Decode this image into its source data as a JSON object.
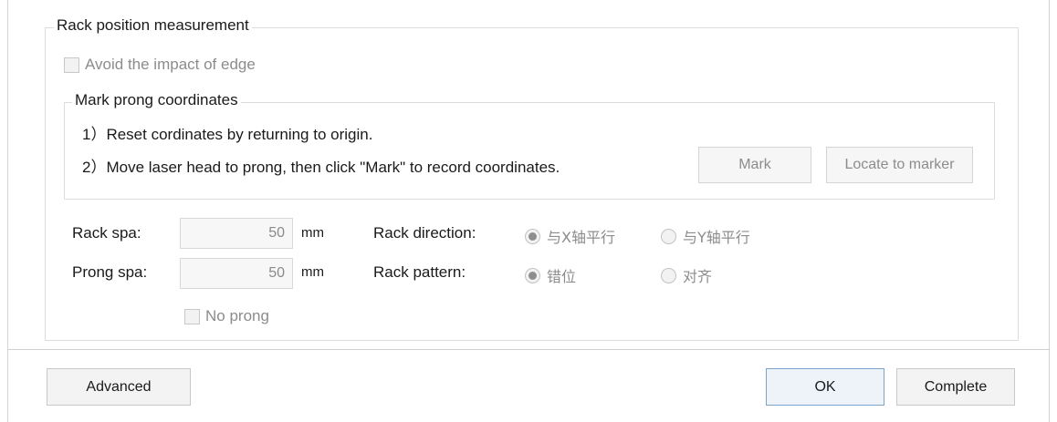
{
  "rack_group": {
    "title": "Rack position measurement",
    "avoid_edge_label": "Avoid the impact of edge"
  },
  "mark_group": {
    "title": "Mark prong coordinates",
    "step1": "1）Reset cordinates by returning to origin.",
    "step2": "2）Move laser head to prong, then click \"Mark\" to record coordinates.",
    "mark_button": "Mark",
    "locate_button": "Locate to marker"
  },
  "fields": {
    "rack_spa_label": "Rack spa:",
    "rack_spa_value": "50",
    "rack_spa_unit": "mm",
    "prong_spa_label": "Prong spa:",
    "prong_spa_value": "50",
    "prong_spa_unit": "mm",
    "no_prong_label": "No prong"
  },
  "rack_direction": {
    "label": "Rack direction:",
    "options": [
      {
        "label": "与X轴平行",
        "selected": true
      },
      {
        "label": "与Y轴平行",
        "selected": false
      }
    ]
  },
  "rack_pattern": {
    "label": "Rack pattern:",
    "options": [
      {
        "label": "错位",
        "selected": true
      },
      {
        "label": "对齐",
        "selected": false
      }
    ]
  },
  "footer": {
    "advanced_button": "Advanced",
    "ok_button": "OK",
    "complete_button": "Complete"
  }
}
